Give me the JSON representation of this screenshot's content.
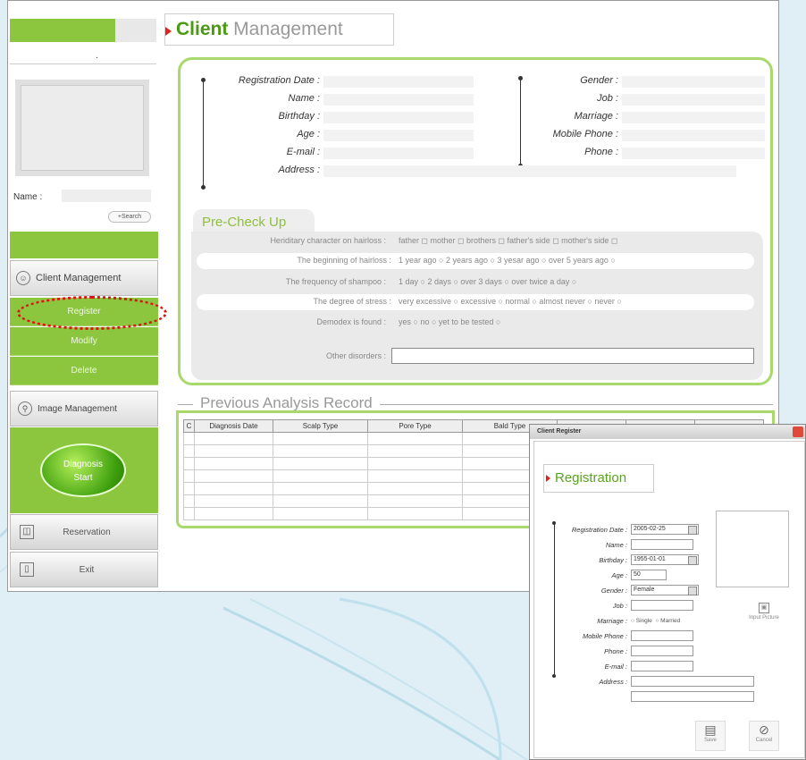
{
  "header": {
    "title_bold": "Client",
    "title_rest": " Management"
  },
  "sidebar": {
    "dot": ".",
    "name_label": "Name :",
    "search_button": "+Search",
    "menu_client": "Client Management",
    "sub_register": "Register",
    "sub_modify": "Modify",
    "sub_delete": "Delete",
    "menu_image": "Image Management",
    "diagnosis_line1": "Diagnosis",
    "diagnosis_line2": "Start",
    "menu_reservation": "Reservation",
    "menu_exit": "Exit"
  },
  "client_info": {
    "left_labels": [
      "Registration Date :",
      "Name :",
      "Birthday :",
      "Age :",
      "E-mail :",
      "Address :"
    ],
    "right_labels": [
      "Gender :",
      "Job :",
      "Marriage :",
      "Mobile Phone :",
      "Phone :"
    ]
  },
  "precheck": {
    "title": "Pre-Check Up",
    "rows": [
      {
        "q": "Heriditary character on hairloss :",
        "a": "father ◻   mother ◻   brothers ◻   father's side ◻   mother's side ◻"
      },
      {
        "q": "The beginning of hairloss :",
        "a": "1 year ago ○   2 years ago ○   3 yesar ago ○   over 5 years ago ○"
      },
      {
        "q": "The frequency of shampoo :",
        "a": "1 day ○   2 days ○   over 3 days ○   over twice a day ○"
      },
      {
        "q": "The degree of stress :",
        "a": "very excessive ○   excessive ○   normal ○   almost never ○   never ○"
      },
      {
        "q": "Demodex is found :",
        "a": "yes ○    no ○    yet to be tested ○"
      },
      {
        "q": "Other disorders :",
        "a": ""
      }
    ]
  },
  "records": {
    "title": "Previous Analysis Record",
    "columns": [
      "C",
      "Diagnosis Date",
      "Scalp Type",
      "Pore Type",
      "Bald Type",
      "",
      "",
      ""
    ]
  },
  "dialog": {
    "titlebar": "Client Register",
    "heading": "Registration",
    "labels": [
      "Registration Date :",
      "Name :",
      "Birthday :",
      "Age :",
      "Gender :",
      "Job :",
      "Marriage :",
      "Mobile Phone :",
      "Phone :",
      "E-mail :",
      "Address :"
    ],
    "reg_date": "2005-02-25",
    "birthday": "1955-01-01",
    "age": "50",
    "gender": "Female",
    "marriage_single": "○ Single",
    "marriage_married": "○ Married",
    "input_picture": "Input Picture",
    "save": "Save",
    "cancel": "Cancel"
  }
}
